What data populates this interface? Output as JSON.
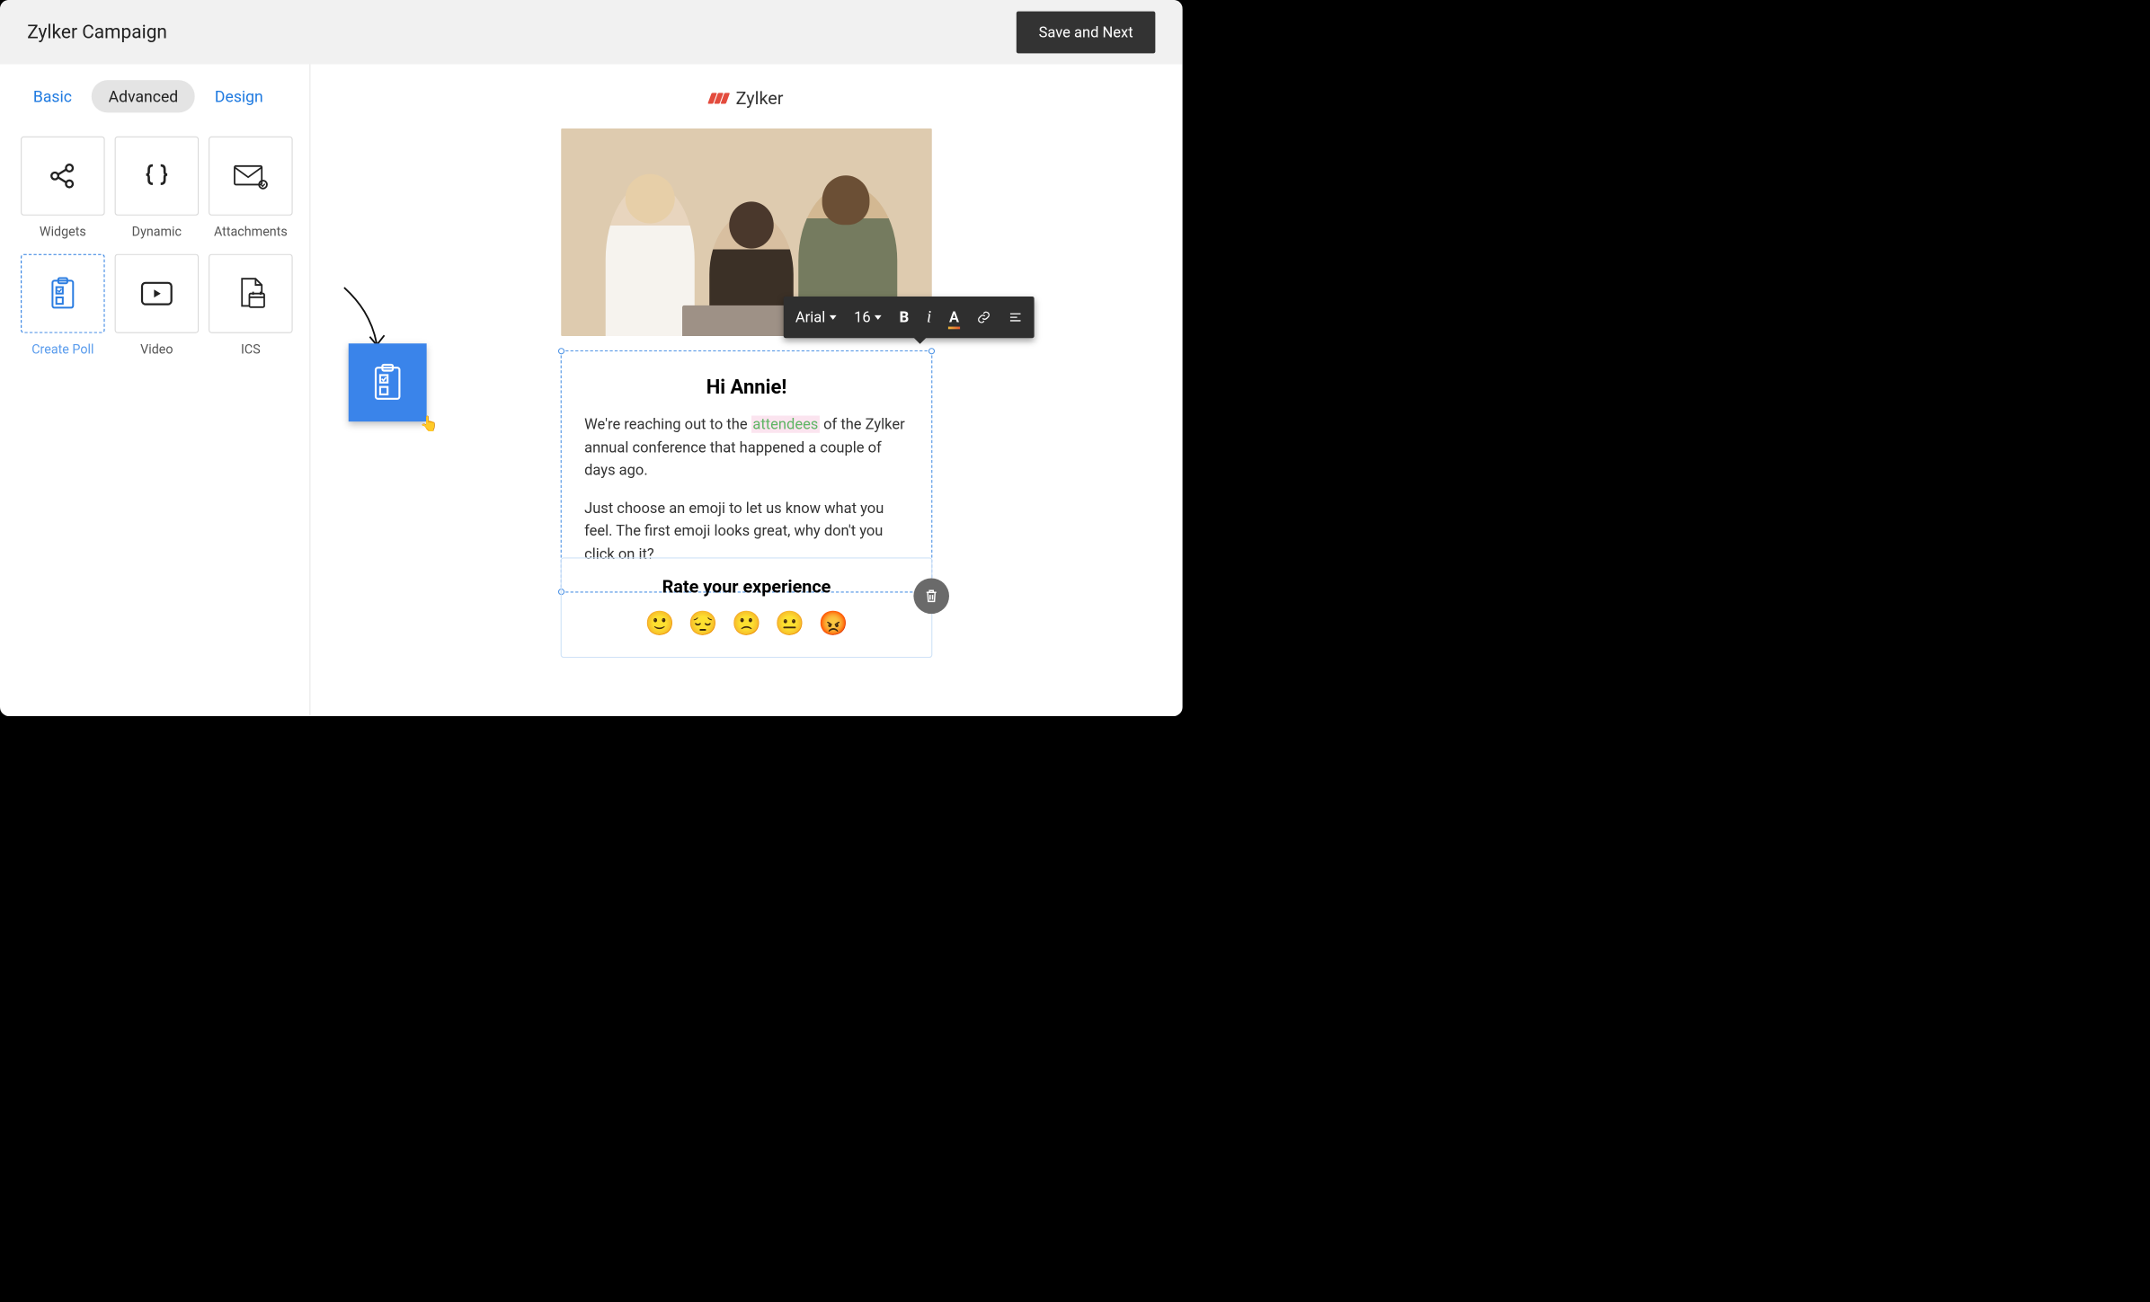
{
  "header": {
    "title": "Zylker Campaign",
    "save_label": "Save and Next"
  },
  "sidebar": {
    "tabs": [
      "Basic",
      "Advanced",
      "Design"
    ],
    "active_tab": "Advanced",
    "items": [
      {
        "icon": "share-icon",
        "label": "Widgets",
        "selected": false
      },
      {
        "icon": "braces-icon",
        "label": "Dynamic",
        "selected": false
      },
      {
        "icon": "envelope-icon",
        "label": "Attachments",
        "selected": false
      },
      {
        "icon": "poll-icon",
        "label": "Create Poll",
        "selected": true
      },
      {
        "icon": "video-icon",
        "label": "Video",
        "selected": false
      },
      {
        "icon": "calendar-icon",
        "label": "ICS",
        "selected": false
      }
    ]
  },
  "canvas": {
    "brand_name": "Zylker",
    "greeting": "Hi Annie!",
    "para1_pre": "We're reaching out to the ",
    "para1_merge": "attendees",
    "para1_post": " of the Zylker annual conference that happened a couple of days ago.",
    "para2": "Just choose an emoji to let us know what you feel. The first emoji looks great, why don't you click on it?",
    "poll_title": "Rate your experience",
    "emojis": [
      "🙂",
      "😔",
      "🙁",
      "😐",
      "😡"
    ]
  },
  "toolbar": {
    "font": "Arial",
    "size": "16",
    "bold": "B",
    "italic_symbol": "i"
  },
  "drag": {
    "item_label": "Create Poll"
  }
}
